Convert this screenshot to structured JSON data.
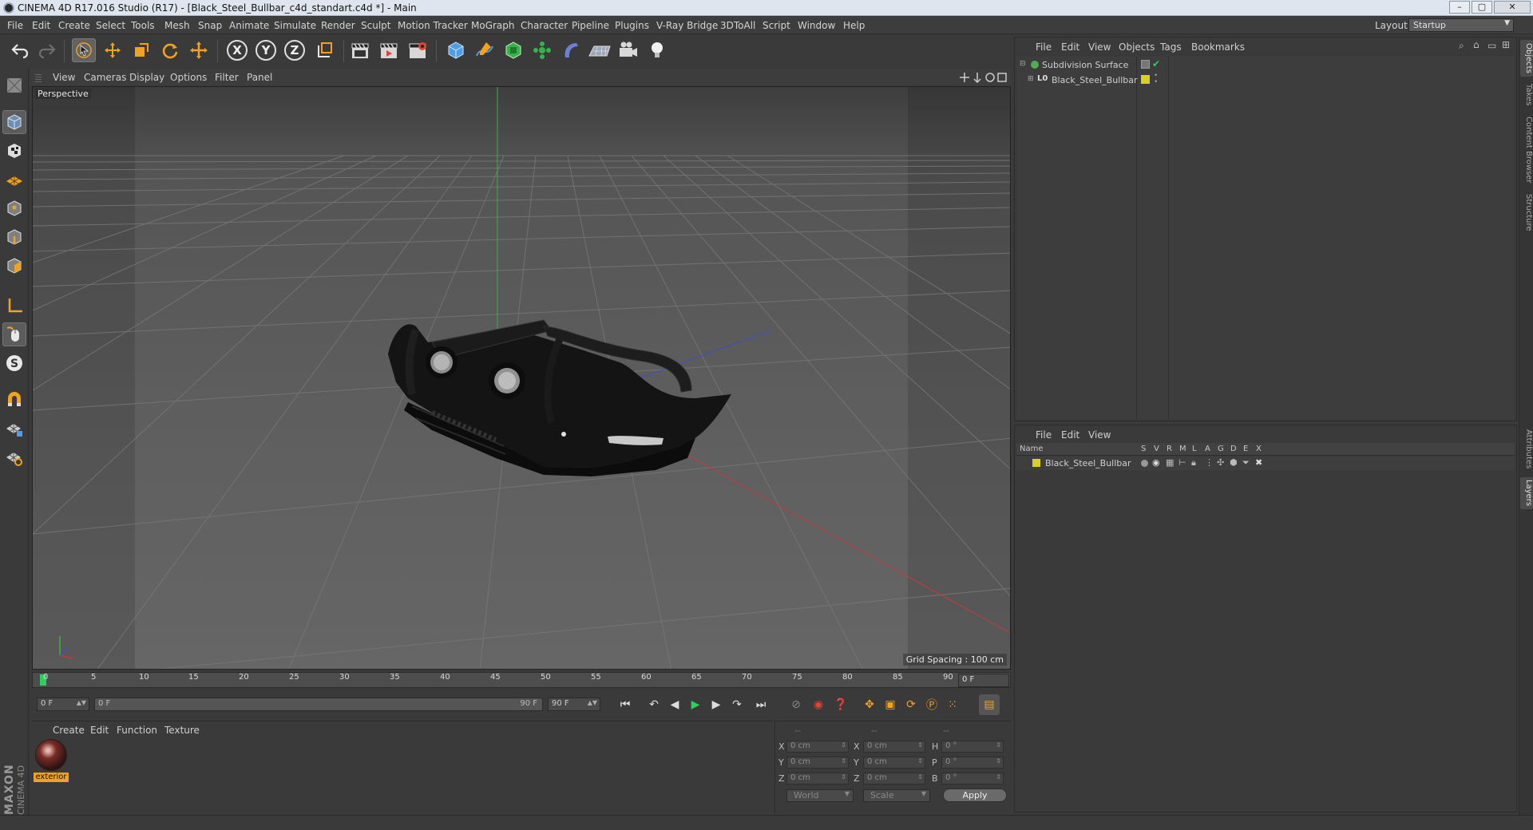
{
  "window": {
    "title": "CINEMA 4D R17.016 Studio (R17) - [Black_Steel_Bullbar_c4d_standart.c4d *] - Main",
    "controls": [
      "–",
      "▢",
      "✕"
    ]
  },
  "menubar": {
    "items": [
      "File",
      "Edit",
      "Create",
      "Select",
      "Tools",
      "Mesh",
      "Snap",
      "Animate",
      "Simulate",
      "Render",
      "Sculpt",
      "Motion Tracker",
      "MoGraph",
      "Character",
      "Pipeline",
      "Plugins",
      "V-Ray Bridge",
      "3DToAll",
      "Script",
      "Window",
      "Help"
    ],
    "layout_label": "Layout:",
    "layout_value": "Startup"
  },
  "toolbar": {
    "axis_x": "X",
    "axis_y": "Y",
    "axis_z": "Z"
  },
  "viewport": {
    "menu": [
      "View",
      "Cameras",
      "Display",
      "Options",
      "Filter",
      "Panel"
    ],
    "camera_label": "Perspective",
    "grid_spacing": "Grid Spacing : 100 cm"
  },
  "timeline": {
    "ticks": [
      "0",
      "5",
      "10",
      "15",
      "20",
      "25",
      "30",
      "35",
      "40",
      "45",
      "50",
      "55",
      "60",
      "65",
      "70",
      "75",
      "80",
      "85",
      "90"
    ],
    "current_frame": "0 F",
    "start_field": "0 F",
    "range_start": "0 F",
    "range_end": "90 F",
    "end_field": "90 F"
  },
  "material_manager": {
    "menu": [
      "Create",
      "Edit",
      "Function",
      "Texture"
    ],
    "material_name": "exterior"
  },
  "coordinates": {
    "headers": [
      "--",
      "--",
      "--"
    ],
    "rows": [
      {
        "l1": "X",
        "v1": "0 cm",
        "l2": "X",
        "v2": "0 cm",
        "l3": "H",
        "v3": "0 °"
      },
      {
        "l1": "Y",
        "v1": "0 cm",
        "l2": "Y",
        "v2": "0 cm",
        "l3": "P",
        "v3": "0 °"
      },
      {
        "l1": "Z",
        "v1": "0 cm",
        "l2": "Z",
        "v2": "0 cm",
        "l3": "B",
        "v3": "0 °"
      }
    ],
    "space_select": "World",
    "mode_select": "Scale",
    "apply_label": "Apply"
  },
  "logo": {
    "brand": "MAXON",
    "product": "CINEMA 4D"
  },
  "object_manager": {
    "menu": [
      "File",
      "Edit",
      "View",
      "Objects",
      "Tags",
      "Bookmarks"
    ],
    "objects": [
      {
        "name": "Subdivision Surface",
        "color": "#4caf50"
      },
      {
        "name": "Black_Steel_Bullbar",
        "color": "#d9d21a"
      }
    ]
  },
  "layer_manager": {
    "menu": [
      "File",
      "Edit",
      "View"
    ],
    "columns": [
      "Name",
      "S",
      "V",
      "R",
      "M",
      "L",
      "A",
      "G",
      "D",
      "E",
      "X"
    ],
    "layers": [
      {
        "name": "Black_Steel_Bullbar",
        "color": "#d9d21a"
      }
    ]
  },
  "right_tabs": [
    "Objects",
    "Takes",
    "Content Browser",
    "Structure",
    "Attributes",
    "Layers"
  ],
  "colors": {
    "accent_orange": "#f2a21f",
    "active_green": "#2dcf5e",
    "axis_x": "#c83a3a",
    "axis_y": "#3cb043",
    "axis_z": "#3a4fd0"
  }
}
